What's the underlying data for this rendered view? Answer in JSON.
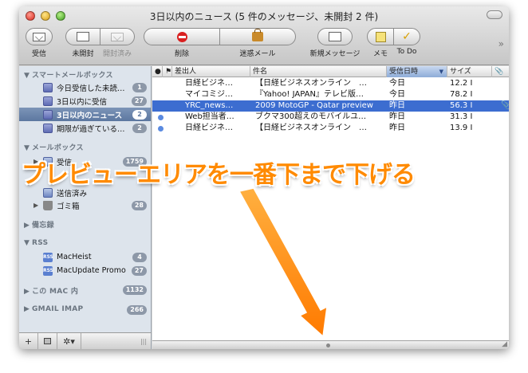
{
  "window": {
    "title": "3日以内のニュース (5 件のメッセージ、未開封 2 件)"
  },
  "toolbar": {
    "inbox_label": "受信",
    "unread_label": "未開封",
    "read_label": "開封済み",
    "delete_label": "削除",
    "junk_label": "迷惑メール",
    "new_message_label": "新規メッセージ",
    "memo_label": "メモ",
    "todo_label": "To Do"
  },
  "sidebar": {
    "smart_header": "スマートメールボックス",
    "smart_items": [
      {
        "label": "今日受信した未読…",
        "count": "1"
      },
      {
        "label": "3日以内に受信",
        "count": "27"
      },
      {
        "label": "3日以内のニュース",
        "count": "2"
      },
      {
        "label": "期限が過ぎている…",
        "count": "2"
      }
    ],
    "mailbox_header": "メールボックス",
    "mailbox_items": [
      {
        "label": "受信",
        "count": "1759"
      },
      {
        "label": "送信済み",
        "count": ""
      },
      {
        "label": "ゴミ箱",
        "count": "28"
      }
    ],
    "notes_header": "備忘録",
    "rss_header": "RSS",
    "rss_items": [
      {
        "label": "MacHeist",
        "count": "4"
      },
      {
        "label": "MacUpdate Promo",
        "count": "27"
      }
    ],
    "onmymac_header": "この MAC 内",
    "onmymac_count": "1132",
    "gmail_header": "GMAIL IMAP",
    "gmail_count": "266",
    "icons": {
      "smart": "smart-mailbox-icon",
      "inbox": "inbox-icon",
      "trash": "trash-icon",
      "rss": "rss-icon"
    }
  },
  "list": {
    "columns": {
      "unread": "●",
      "flag": "⚑",
      "from": "差出人",
      "subject": "件名",
      "date": "受信日時",
      "size": "サイズ",
      "attachment": "📎"
    },
    "rows": [
      {
        "unread": false,
        "from": "日経ビジネ…",
        "subject": "【日経ビジネスオンライン　…",
        "date": "今日",
        "size": "12.2 I",
        "attach": false,
        "selected": false
      },
      {
        "unread": false,
        "from": "マイコミジ…",
        "subject": "『Yahoo! JAPAN』テレビ版…",
        "date": "今日",
        "size": "78.2 I",
        "attach": false,
        "selected": false
      },
      {
        "unread": false,
        "from": "YRC_news…",
        "subject": "2009 MotoGP - Qatar preview",
        "date": "昨日",
        "size": "56.3 I",
        "attach": true,
        "selected": true
      },
      {
        "unread": true,
        "from": "Web担当者…",
        "subject": "ブクマ300超えのモバイルユ…",
        "date": "昨日",
        "size": "31.3 I",
        "attach": false,
        "selected": false
      },
      {
        "unread": true,
        "from": "日経ビジネ…",
        "subject": "【日経ビジネスオンライン　…",
        "date": "昨日",
        "size": "13.9 I",
        "attach": false,
        "selected": false
      }
    ]
  },
  "annotation": {
    "text": "プレビューエリアを一番下まで下げる",
    "color": "#ff8a00"
  },
  "bottom_bar": {
    "add": "+",
    "gear": "✲▾",
    "grip": "|||"
  },
  "colors": {
    "selection": "#3c6dd0",
    "sidebar_bg": "#dde4ec",
    "sidebar_selected": "#5c77a0"
  }
}
